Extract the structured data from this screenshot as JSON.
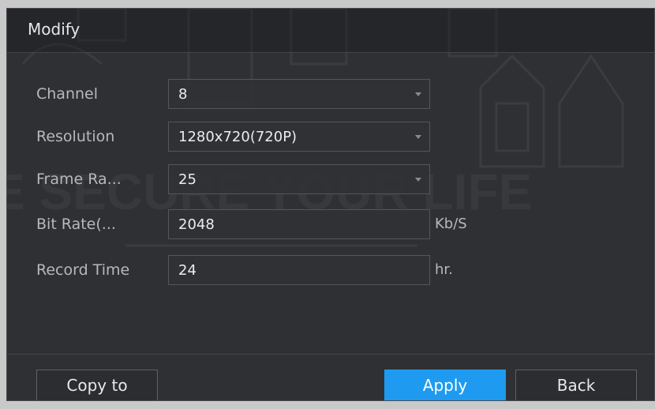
{
  "dialog": {
    "title": "Modify"
  },
  "form": {
    "channel": {
      "label": "Channel",
      "value": "8"
    },
    "resolution": {
      "label": "Resolution",
      "value": "1280x720(720P)"
    },
    "frame_rate": {
      "label": "Frame Ra...",
      "value": "25"
    },
    "bit_rate": {
      "label": "Bit Rate(...",
      "value": "2048",
      "unit": "Kb/S"
    },
    "record_time": {
      "label": "Record Time",
      "value": "24",
      "unit": "hr."
    }
  },
  "buttons": {
    "copy_to": "Copy to",
    "apply": "Apply",
    "back": "Back"
  },
  "background_watermark": {
    "text": "E SECURE YOUR LIFE"
  },
  "colors": {
    "accent": "#1e9bf0",
    "panel": "#2f3033",
    "field_border": "#55565a"
  }
}
